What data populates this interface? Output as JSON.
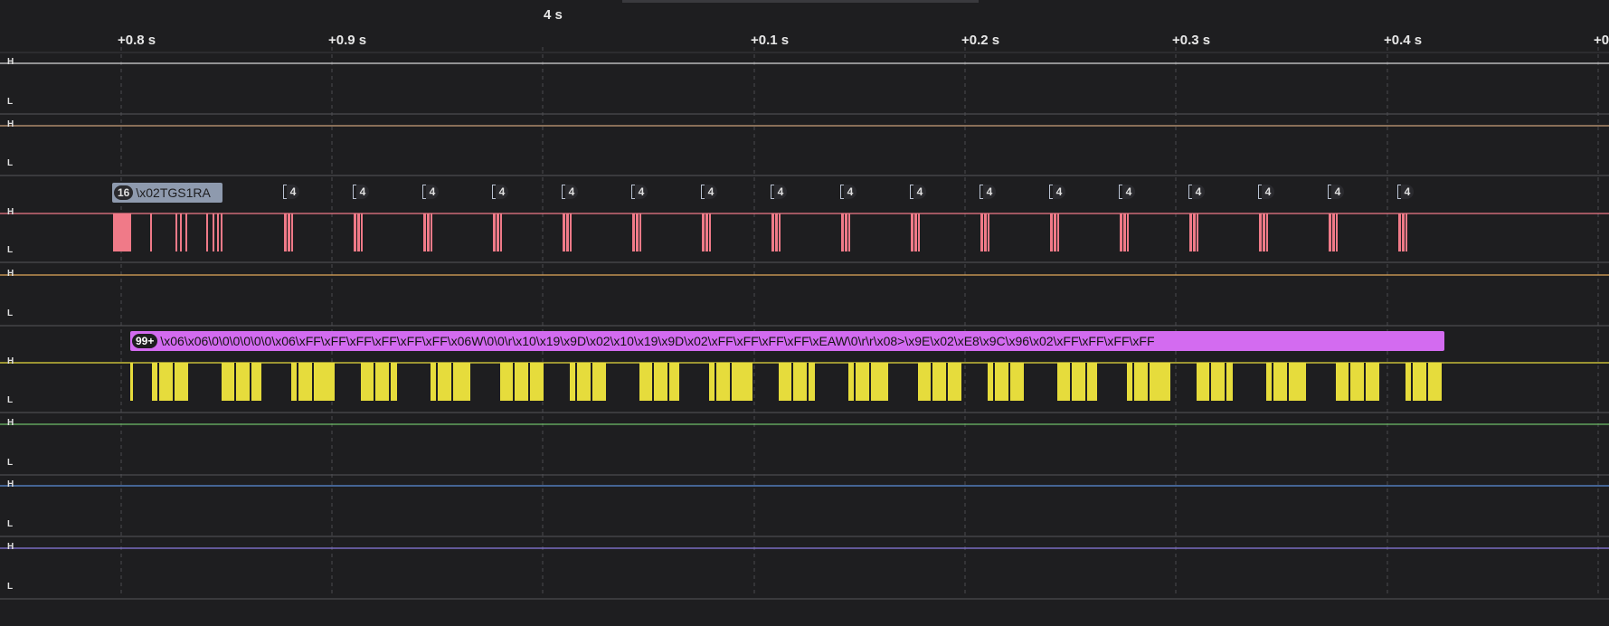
{
  "timeline": {
    "major_label": "4 s",
    "ticks": [
      "+0.8 s",
      "+0.9 s",
      "+0.1 s",
      "+0.2 s",
      "+0.3 s",
      "+0.4 s",
      "+0"
    ]
  },
  "level_labels": {
    "high": "H",
    "low": "L"
  },
  "channels": [
    {
      "color": "#d9d9d9"
    },
    {
      "color": "#c9a07a"
    },
    {
      "color": "#f07a88"
    },
    {
      "color": "#e1a85a"
    },
    {
      "color": "#e6dc3c"
    },
    {
      "color": "#6fbf6a"
    },
    {
      "color": "#5b8fd9"
    },
    {
      "color": "#8a7ce0"
    }
  ],
  "ch2_protocol": {
    "count": "16",
    "text": "\\x02TGS1RA",
    "mini_count": "4"
  },
  "ch4_protocol": {
    "count": "99+",
    "text": "\\x06\\x06\\0\\0\\0\\0\\0\\0\\x06\\xFF\\xFF\\xFF\\xFF\\xFF\\xFF\\x06W\\0\\0\\r\\x10\\x19\\x9D\\x02\\x10\\x19\\x9D\\x02\\xFF\\xFF\\xFF\\xFF\\xEAW\\0\\r\\r\\x08>\\x9E\\x02\\xE8\\x9C\\x96\\x02\\xFF\\xFF\\xFF\\xFF"
  }
}
